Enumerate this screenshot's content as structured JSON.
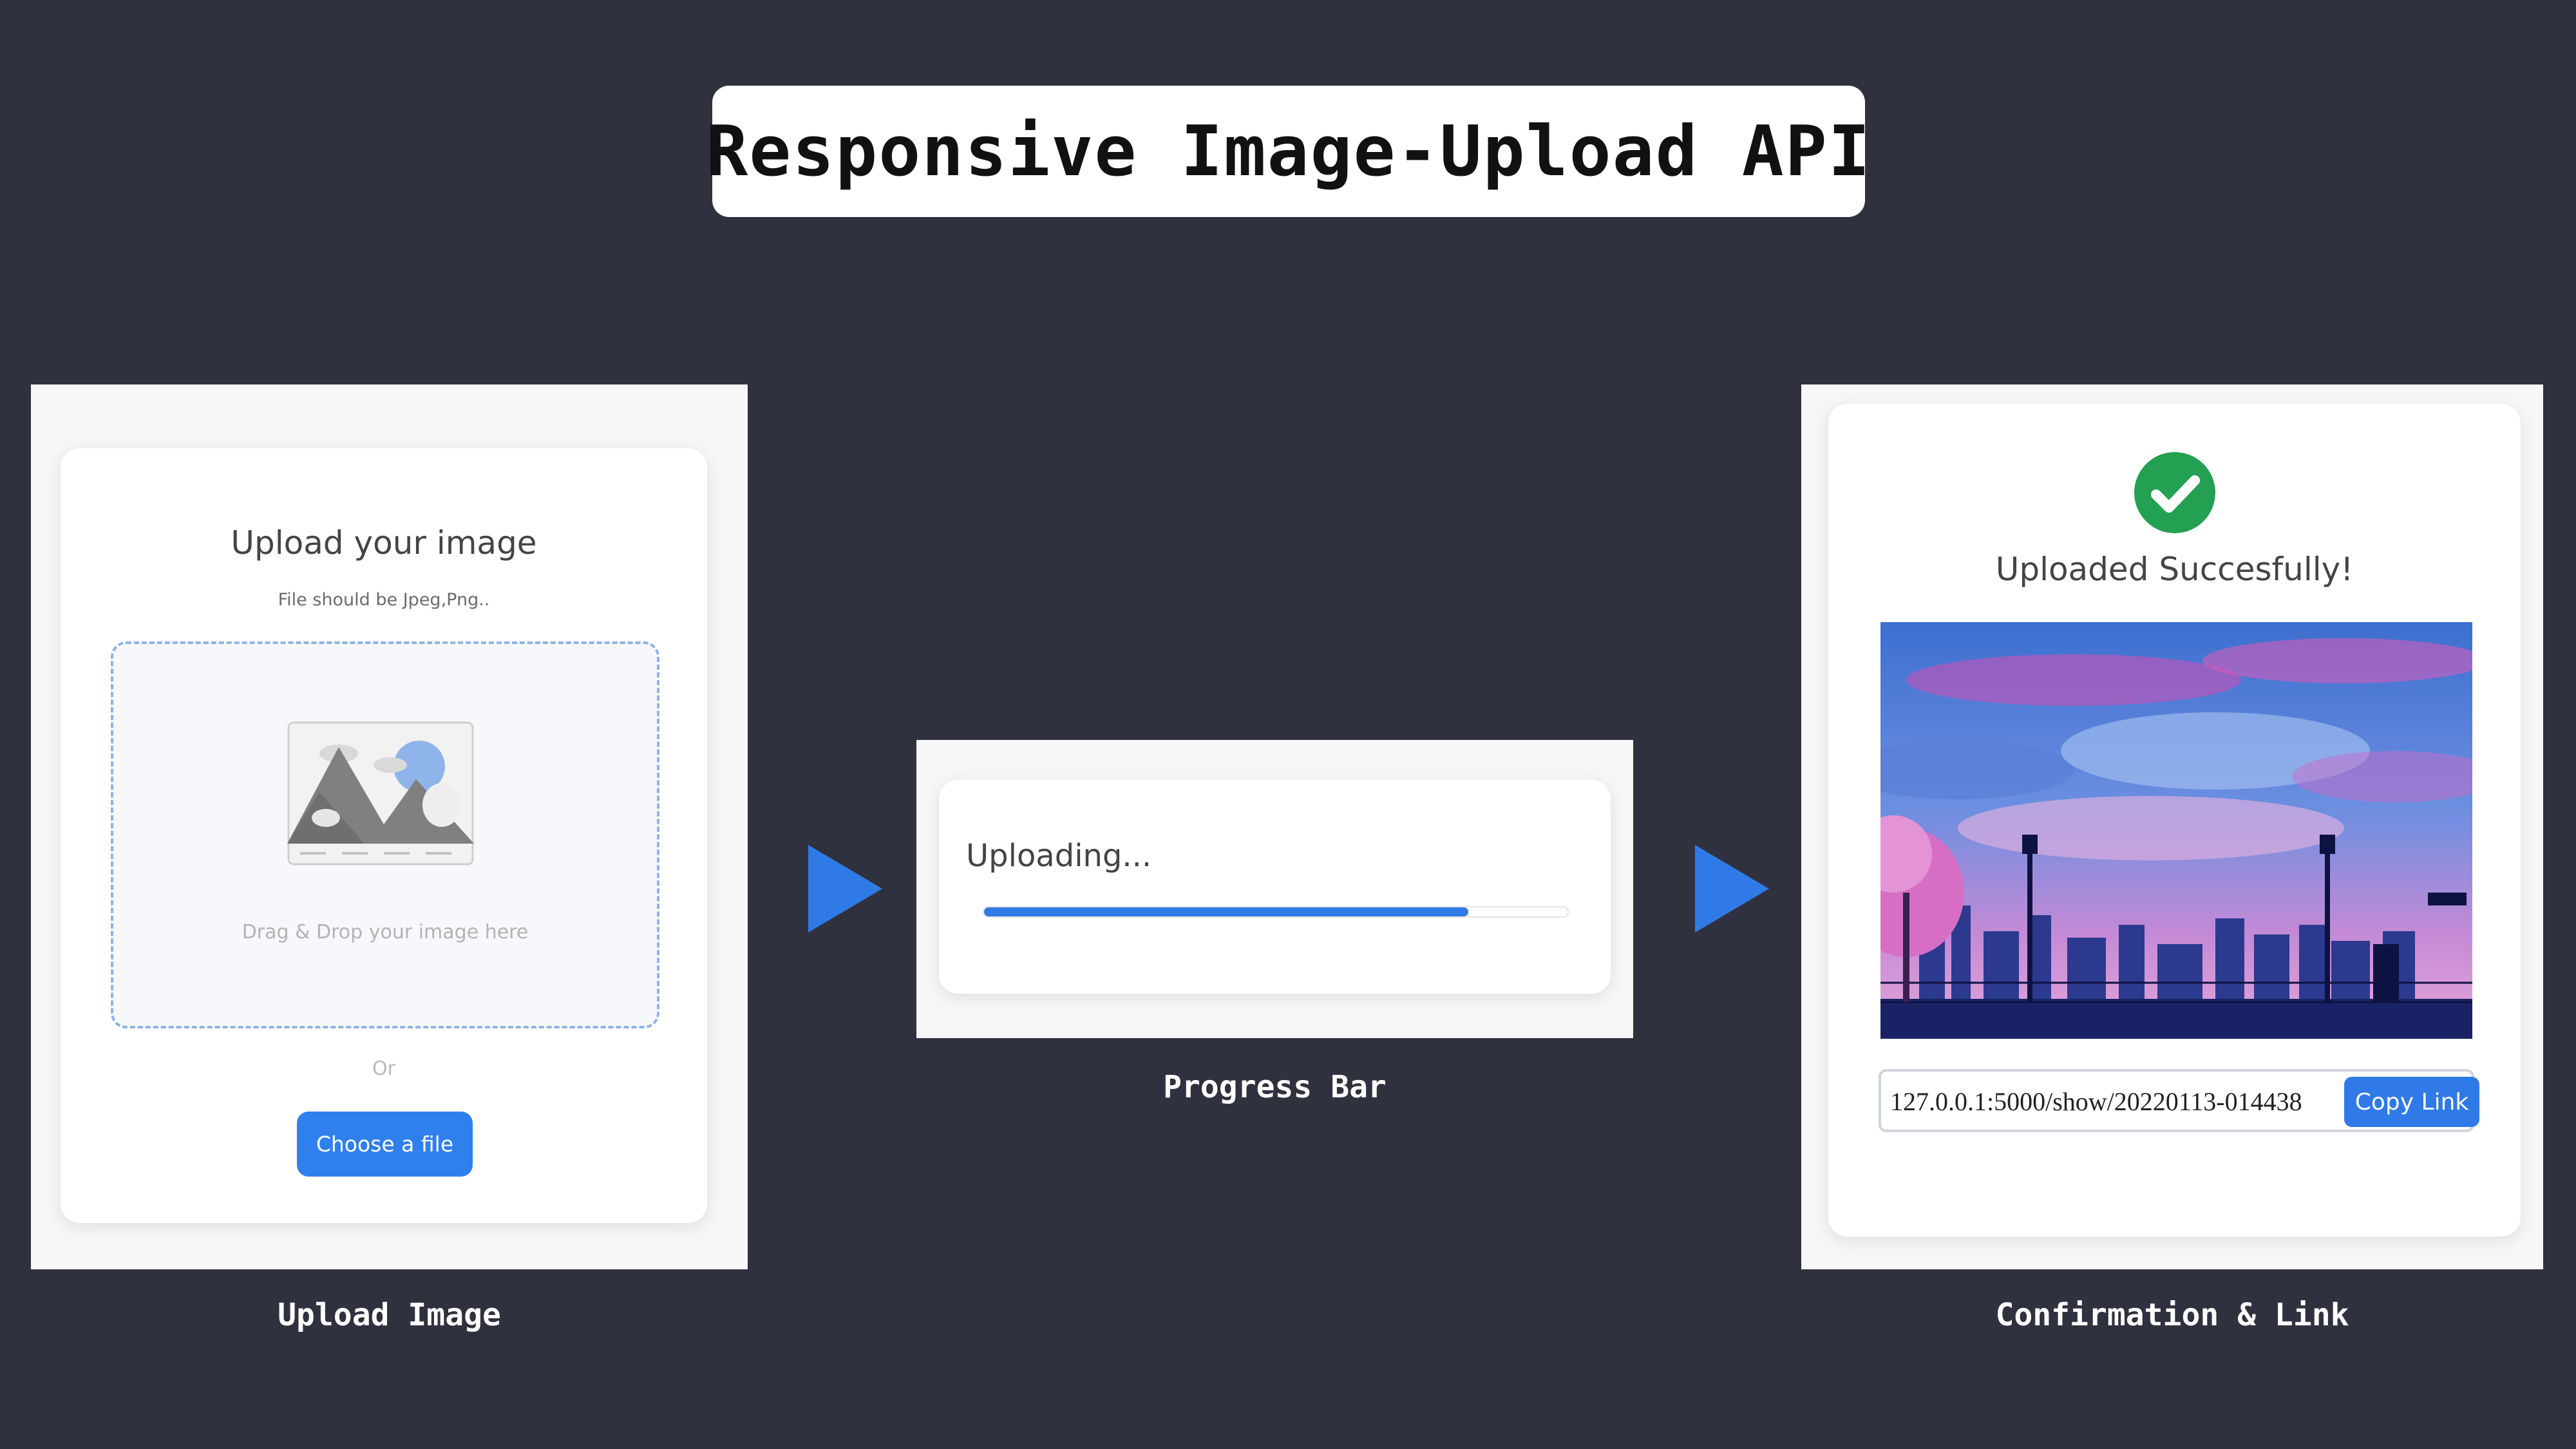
{
  "title": "Responsive Image-Upload API",
  "colors": {
    "background": "#30313f",
    "accent_blue": "#2f7ae6",
    "success_green": "#23a051"
  },
  "panel_upload": {
    "heading": "Upload your image",
    "subheading": "File should be Jpeg,Png..",
    "dropzone_text": "Drag & Drop your image here",
    "dropzone_icon": "image-placeholder-icon",
    "or_text": "Or",
    "choose_button": "Choose a file",
    "caption": "Upload Image"
  },
  "panel_progress": {
    "status_text": "Uploading...",
    "progress_percent": 83,
    "caption": "Progress Bar"
  },
  "panel_confirm": {
    "status_icon": "check-circle-icon",
    "message": "Uploaded Succesfully!",
    "link_value": "127.0.0.1:5000/show/20220113-014438",
    "copy_button": "Copy Link",
    "caption": "Confirmation & Link"
  },
  "arrows": [
    "arrow-right-icon",
    "arrow-right-icon"
  ]
}
